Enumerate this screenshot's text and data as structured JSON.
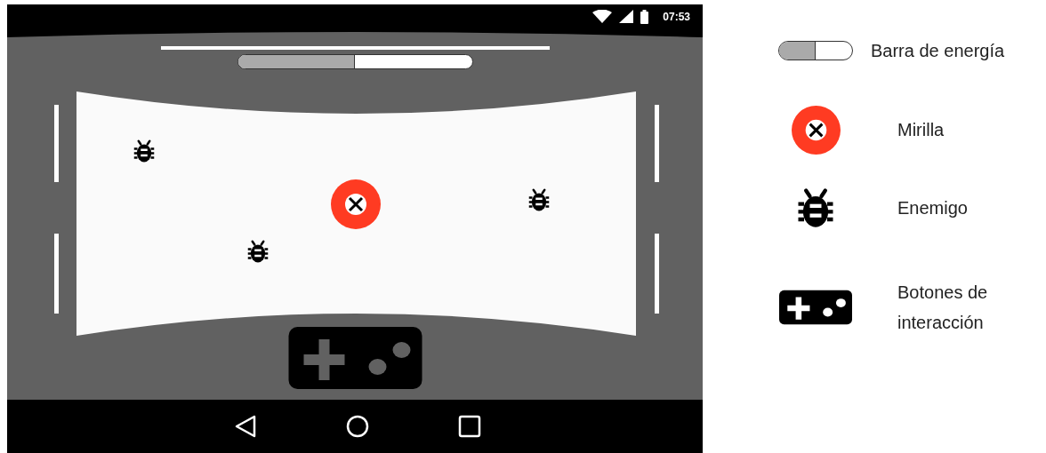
{
  "status_bar": {
    "time": "07:53"
  },
  "hud": {
    "energy_bar": {
      "level": 0.5
    }
  },
  "legend": [
    {
      "kind": "energy_bar",
      "label": "Barra de energía",
      "level": 0.5
    },
    {
      "kind": "crosshair",
      "label": "Mirilla"
    },
    {
      "kind": "enemy",
      "label": "Enemigo"
    },
    {
      "kind": "controls",
      "label": "Botones de interacción"
    }
  ]
}
